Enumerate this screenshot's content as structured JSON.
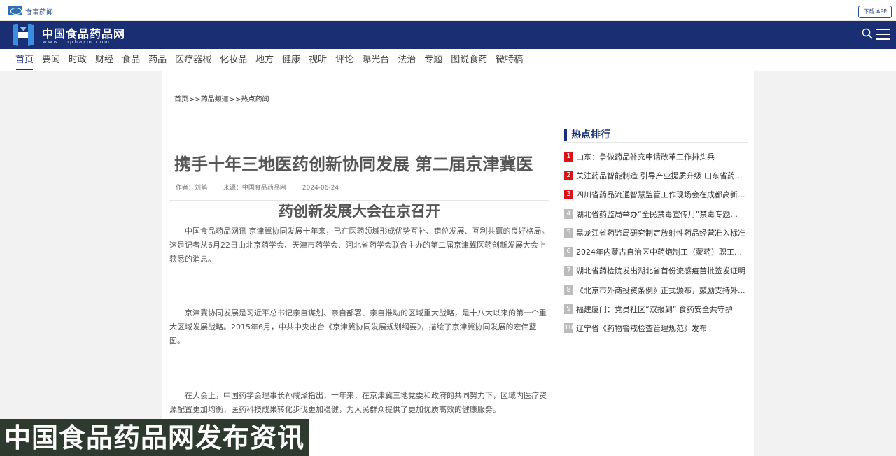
{
  "topbar": {
    "site_label": "食事药闻",
    "download_label": "下载 APP"
  },
  "brand": {
    "name": "中国食品药品网",
    "url": "www.cnpharm.com"
  },
  "nav": [
    "首页",
    "要闻",
    "时政",
    "财经",
    "食品",
    "药品",
    "医疗器械",
    "化妆品",
    "地方",
    "健康",
    "视听",
    "评论",
    "曝光台",
    "法治",
    "专题",
    "图说食药",
    "微特稿"
  ],
  "breadcrumb": [
    "首页",
    ">>药品频道",
    ">>热点药闻"
  ],
  "article": {
    "title_line1": "携手十年三地医药创新协同发展 第二届京津冀医",
    "title_line2": "药创新发展大会在京召开",
    "author": "作者：刘鹤",
    "source": "来源：中国食品药品网",
    "date": "2024-06-24",
    "paragraphs": [
      "中国食品药品网讯 京津冀协同发展十年来，已在医药领域形成优势互补、错位发展、互利共赢的良好格局。这是记者从6月22日由北京药学会、天津市药学会、河北省药学会联合主办的第二届京津冀医药创新发展大会上获悉的消息。",
      "京津冀协同发展是习近平总书记亲自谋划、亲自部署、亲自推动的区域重大战略，是十八大以来的第一个重大区域发展战略。2015年6月，中共中央出台《京津冀协同发展规划纲要》，描绘了京津冀协同发展的宏伟蓝图。",
      "在大会上，中国药学会理事长孙咸泽指出，十年来，在京津冀三地党委和政府的共同努力下，区域内医疗资源配置更加均衡，医药科技成果转化步伐更加稳健，为人民群众提供了更加优质高效的健康服务。"
    ]
  },
  "sidebar": {
    "title": "热点排行",
    "items": [
      {
        "num": "1",
        "text": "山东：争做药品补充申请改革工作排头兵"
      },
      {
        "num": "2",
        "text": "关注药品智能制造 引导产业提质升级 山东省药..."
      },
      {
        "num": "3",
        "text": "四川省药品流通智慧监管工作现场会在成都高新..."
      },
      {
        "num": "4",
        "text": "湖北省药监局举办“全民禁毒宣传月”禁毒专题..."
      },
      {
        "num": "5",
        "text": "黑龙江省药监局研究制定放射性药品经营准入标准"
      },
      {
        "num": "6",
        "text": "2024年内蒙古自治区中药炮制工（蒙药）职工职..."
      },
      {
        "num": "7",
        "text": "湖北省药检院发出湖北省首份流感疫苗批签发证明"
      },
      {
        "num": "8",
        "text": "《北京市外商投资条例》正式颁布，鼓励支持外..."
      },
      {
        "num": "9",
        "text": "福建厦门：党员社区“双报到” 食药安全共守护"
      },
      {
        "num": "10",
        "text": "辽宁省《药物警戒检查管理规范》发布"
      }
    ]
  },
  "watermark": "中国食品药品网发布资讯",
  "colors": {
    "brand": "#1a2f73",
    "rank_top": "#d9131a",
    "rank_other": "#bcbcbc"
  }
}
